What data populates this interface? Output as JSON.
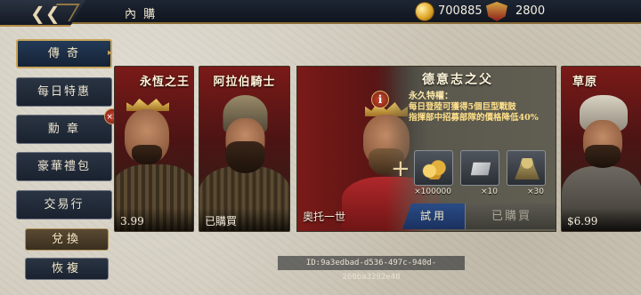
{
  "header": {
    "back_icon": "back-arrow-icon",
    "title": "內 購",
    "gold": "700885",
    "gold_icon": "gold-coin-icon",
    "gems": "2800",
    "gem_icon": "crest-icon"
  },
  "sidebar": {
    "items": [
      {
        "label": "傳 奇",
        "active": true
      },
      {
        "label": "每日特惠"
      },
      {
        "label": "勳 章",
        "badge": "×2"
      },
      {
        "label": "豪華禮包"
      },
      {
        "label": "交易行"
      }
    ],
    "exchange_label": "兌換",
    "restore_label": "恢複"
  },
  "cards": [
    {
      "name": "永恆之王",
      "bottom": "3.99"
    },
    {
      "name": "阿拉伯騎士",
      "bottom": "已購買"
    },
    {
      "name": "草原",
      "bottom": "$6.99"
    }
  ],
  "feature": {
    "title": "德意志之父",
    "perk_title": "永久特權：",
    "perk_lines": [
      "每日登陸可獲得5個巨型戰鼓",
      "指揮部中招募部隊的價格降低40%"
    ],
    "hero_name": "奧托一世",
    "items": [
      {
        "icon": "gold-pile-icon",
        "count": "×100000"
      },
      {
        "icon": "iron-ingot-icon",
        "count": "×10"
      },
      {
        "icon": "soldier-unit-icon",
        "count": "×30"
      }
    ],
    "trial_label": "試用",
    "bought_label": "已購買",
    "info_icon": "info-icon"
  },
  "footer": {
    "id": "ID:9a3edbad-d536-497c-940d-260ba3292e48"
  },
  "colors": {
    "topbar": "#141a24",
    "gold_accent": "#c8a45a",
    "trial_blue": "#2a4c86"
  }
}
